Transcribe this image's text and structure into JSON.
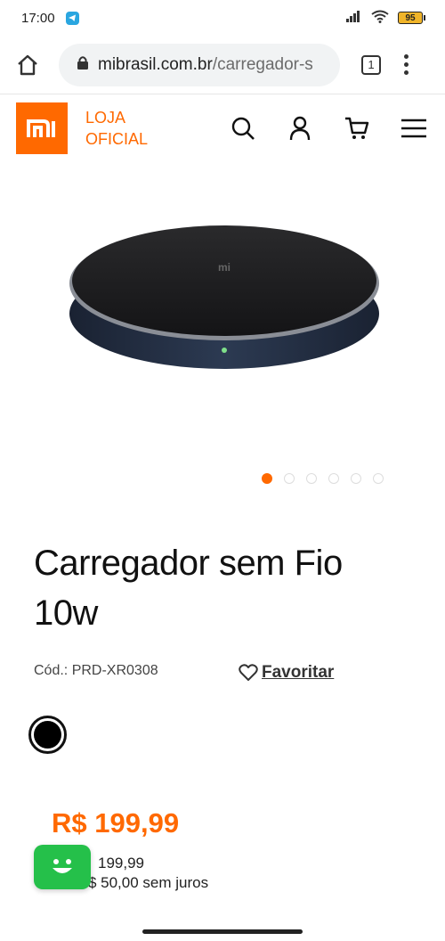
{
  "status_bar": {
    "time": "17:00",
    "battery": "95"
  },
  "browser": {
    "url_host": "mibrasil.com.br",
    "url_path": "/carregador-s",
    "tab_count": "1"
  },
  "header": {
    "logo_text": "mi",
    "store_line1": "LOJA",
    "store_line2": "OFICIAL"
  },
  "gallery": {
    "device_logo": "mi",
    "slide_count": 6,
    "active_slide": 1
  },
  "product": {
    "title": "Carregador sem Fio 10w",
    "sku": "Cód.: PRD-XR0308",
    "favorite_label": "Favoritar",
    "price": "R$ 199,99",
    "price_line1": "199,99",
    "price_line2": "0x R$ 50,00 sem juros"
  },
  "colors": {
    "accent": "#ff6900",
    "chat": "#25c04a"
  }
}
